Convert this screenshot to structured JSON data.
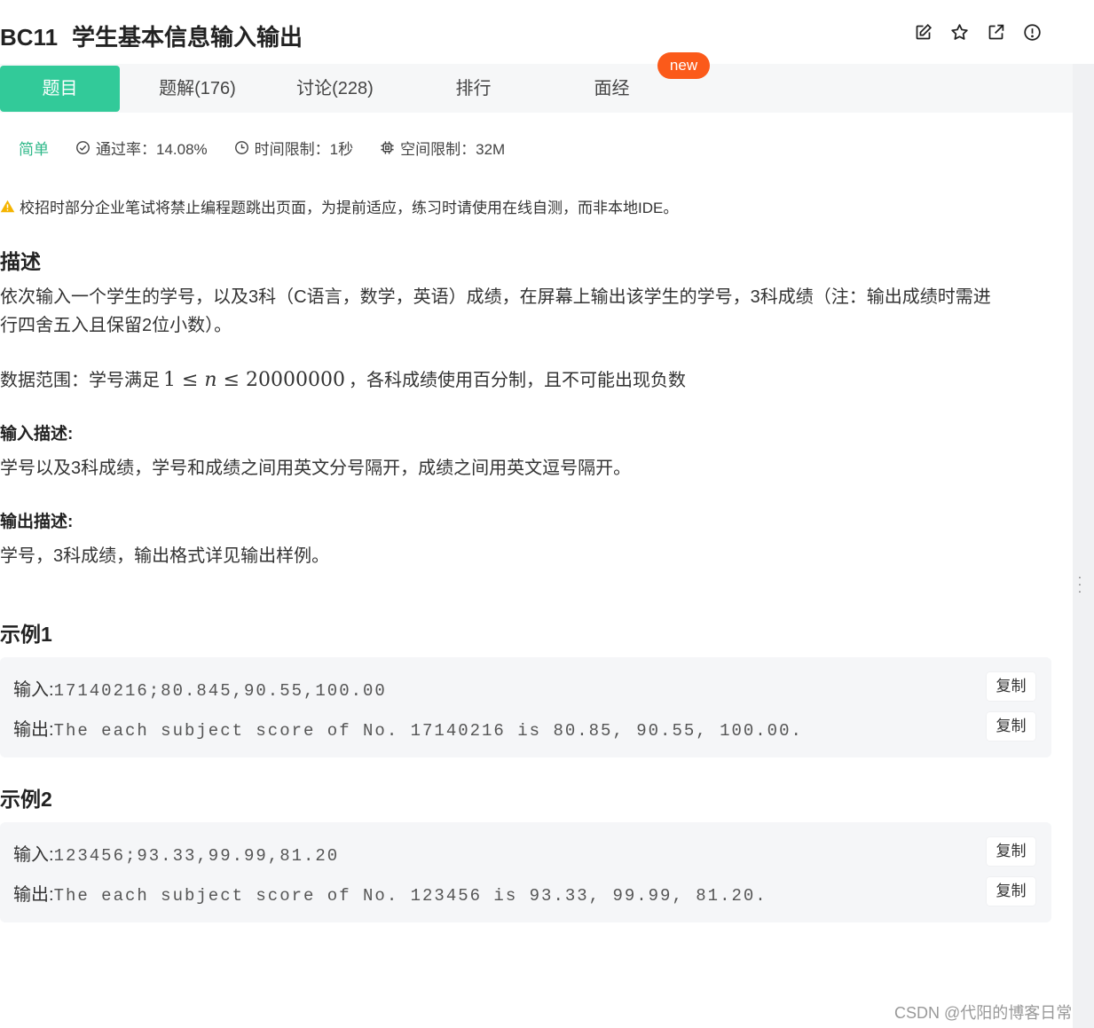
{
  "header": {
    "problem_id": "BC11",
    "problem_title": "学生基本信息输入输出",
    "icons": [
      "edit-icon",
      "star-icon",
      "open-external-icon",
      "report-icon"
    ]
  },
  "tabs": [
    {
      "label": "题目",
      "active": true
    },
    {
      "label": "题解(176)",
      "active": false
    },
    {
      "label": "讨论(228)",
      "active": false
    },
    {
      "label": "排行",
      "active": false
    },
    {
      "label": "面经",
      "active": false,
      "badge": "new"
    }
  ],
  "meta": {
    "difficulty": "简单",
    "pass_rate": "通过率：14.08%",
    "time_limit": "时间限制：1秒",
    "memory_limit": "空间限制：32M"
  },
  "notice": "校招时部分企业笔试将禁止编程题跳出页面，为提前适应，练习时请使用在线自测，而非本地IDE。",
  "description": {
    "heading": "描述",
    "text_line1": "依次输入一个学生的学号，以及3科（C语言，数学，英语）成绩，在屏幕上输出该学生的学号，3科成绩（注：输出成绩时需进",
    "text_line2": "行四舍五入且保留2位小数）。",
    "range_prefix": "数据范围：学号满足",
    "range_math_low": "1",
    "range_math_var": "n",
    "range_math_high": "20000000",
    "range_suffix": "，各科成绩使用百分制，且不可能出现负数"
  },
  "input_desc": {
    "heading": "输入描述:",
    "text": "学号以及3科成绩，学号和成绩之间用英文分号隔开，成绩之间用英文逗号隔开。"
  },
  "output_desc": {
    "heading": "输出描述:",
    "text": "学号，3科成绩，输出格式详见输出样例。"
  },
  "examples": [
    {
      "heading": "示例1",
      "input_label": "输入:",
      "input": "17140216;80.845,90.55,100.00",
      "output_label": "输出:",
      "output": "The each subject score of No. 17140216 is 80.85, 90.55, 100.00.",
      "copy_label": "复制"
    },
    {
      "heading": "示例2",
      "input_label": "输入:",
      "input": "123456;93.33,99.99,81.20",
      "output_label": "输出:",
      "output": "The each subject score of No. 123456 is 93.33, 99.99, 81.20.",
      "copy_label": "复制"
    }
  ],
  "watermark": "CSDN @代阳的博客日常",
  "colors": {
    "accent": "#32ca99",
    "badge": "#fb5a1a",
    "difficulty": "#2fb889",
    "warning": "#f5b400"
  }
}
